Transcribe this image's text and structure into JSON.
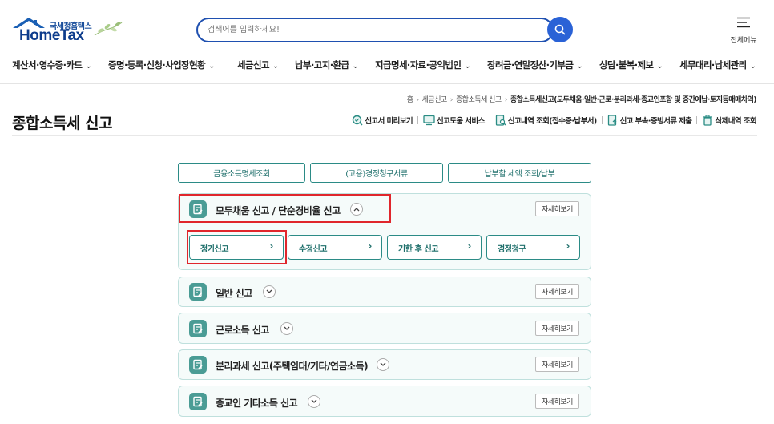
{
  "header": {
    "logo_sub": "국세청홈택스",
    "logo_main": "HomeTax",
    "search_placeholder": "검색어를 입력하세요!",
    "menu_all_label": "전체메뉴"
  },
  "gnb": [
    {
      "label": "계산서·영수증·카드"
    },
    {
      "label": "증명·등록·신청·사업장현황"
    },
    {
      "label": "세금신고"
    },
    {
      "label": "납부·고지·환급"
    },
    {
      "label": "지급명세·자료·공익법인"
    },
    {
      "label": "장려금·연말정산·기부금"
    },
    {
      "label": "상담·불복·제보"
    },
    {
      "label": "세무대리·납세관리"
    }
  ],
  "breadcrumb": {
    "home": "홈",
    "level1": "세금신고",
    "level2": "종합소득세 신고",
    "current": "종합소득세신고(모두채움·일반·근로·분리과세·종교인포함 및 중간예납·토지등매매차익)"
  },
  "page_title": "종합소득세 신고",
  "quick_links": [
    {
      "label": "신고서 미리보기"
    },
    {
      "label": "신고도움 서비스"
    },
    {
      "label": "신고내역 조회(접수증·납부서)"
    },
    {
      "label": "신고 부속·증빙서류 제출"
    },
    {
      "label": "삭제내역 조회"
    }
  ],
  "top_buttons": [
    {
      "label": "금융소득명세조회"
    },
    {
      "label": "(고용)경정청구서류"
    },
    {
      "label": "납부할 세액 조회/납부"
    }
  ],
  "sections": [
    {
      "title": "모두채움 신고 / 단순경비율 신고",
      "detail": "자세히보기",
      "expanded": true
    },
    {
      "title": "일반 신고",
      "detail": "자세히보기",
      "expanded": false
    },
    {
      "title": "근로소득 신고",
      "detail": "자세히보기",
      "expanded": false
    },
    {
      "title": "분리과세 신고(주택임대/기타/연금소득)",
      "detail": "자세히보기",
      "expanded": false
    },
    {
      "title": "종교인 기타소득 신고",
      "detail": "자세히보기",
      "expanded": false
    }
  ],
  "sub_buttons": [
    {
      "label": "정기신고"
    },
    {
      "label": "수정신고"
    },
    {
      "label": "기한 후 신고"
    },
    {
      "label": "경정청구"
    }
  ],
  "colors": {
    "brand": "#0d3c8c",
    "search_border": "#1f50b0",
    "teal": "#2b8b86",
    "highlight": "#e0262c"
  }
}
